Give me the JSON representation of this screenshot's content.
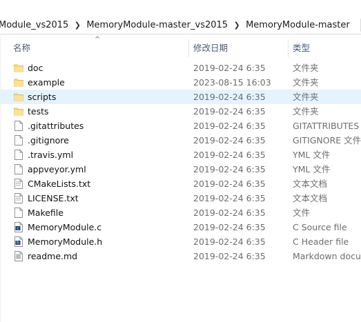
{
  "breadcrumb": {
    "segments": [
      "Module_vs2015",
      "MemoryModule-master_vs2015",
      "MemoryModule-master"
    ],
    "separator": ">"
  },
  "columns": {
    "name": "名称",
    "date": "修改日期",
    "type": "类型",
    "sort_indicator": "^"
  },
  "files": [
    {
      "name": "doc",
      "date": "2019-02-24 6:35",
      "type": "文件夹",
      "icon": "folder-icon",
      "selected": false
    },
    {
      "name": "example",
      "date": "2023-08-15 16:03",
      "type": "文件夹",
      "icon": "folder-icon",
      "selected": false
    },
    {
      "name": "scripts",
      "date": "2019-02-24 6:35",
      "type": "文件夹",
      "icon": "folder-icon",
      "selected": true
    },
    {
      "name": "tests",
      "date": "2019-02-24 6:35",
      "type": "文件夹",
      "icon": "folder-icon",
      "selected": false
    },
    {
      "name": ".gitattributes",
      "date": "2019-02-24 6:35",
      "type": "GITATTRIBUTES ...",
      "icon": "file-icon",
      "selected": false
    },
    {
      "name": ".gitignore",
      "date": "2019-02-24 6:35",
      "type": "GITIGNORE 文件",
      "icon": "file-icon",
      "selected": false
    },
    {
      "name": ".travis.yml",
      "date": "2019-02-24 6:35",
      "type": "YML 文件",
      "icon": "file-icon",
      "selected": false
    },
    {
      "name": "appveyor.yml",
      "date": "2019-02-24 6:35",
      "type": "YML 文件",
      "icon": "file-icon",
      "selected": false
    },
    {
      "name": "CMakeLists.txt",
      "date": "2019-02-24 6:35",
      "type": "文本文档",
      "icon": "text-file-icon",
      "selected": false
    },
    {
      "name": "LICENSE.txt",
      "date": "2019-02-24 6:35",
      "type": "文本文档",
      "icon": "text-file-icon",
      "selected": false
    },
    {
      "name": "Makefile",
      "date": "2019-02-24 6:35",
      "type": "文件",
      "icon": "file-icon",
      "selected": false
    },
    {
      "name": "MemoryModule.c",
      "date": "2019-02-24 6:35",
      "type": "C Source file",
      "icon": "c-source-icon",
      "selected": false
    },
    {
      "name": "MemoryModule.h",
      "date": "2019-02-24 6:35",
      "type": "C Header file",
      "icon": "h-header-icon",
      "selected": false
    },
    {
      "name": "readme.md",
      "date": "2019-02-24 6:35",
      "type": "Markdown docu...",
      "icon": "markdown-file-icon",
      "selected": false
    }
  ],
  "colors": {
    "selection": "#e5f3ff",
    "folder": "#f8d775",
    "header_text": "#4d5b75"
  }
}
